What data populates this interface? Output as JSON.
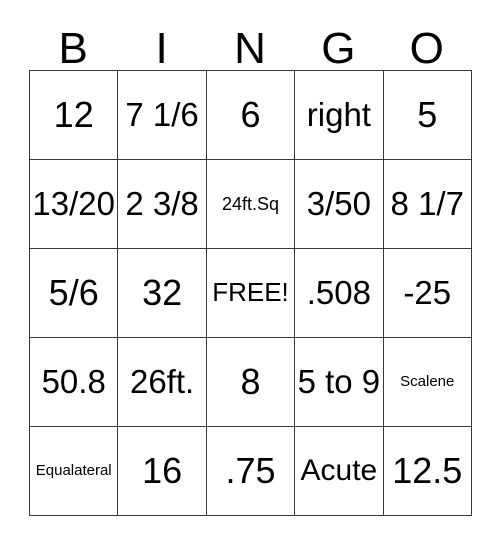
{
  "card": {
    "headers": [
      "B",
      "I",
      "N",
      "G",
      "O"
    ],
    "rows": [
      [
        {
          "text": "12",
          "size": "fs-xl"
        },
        {
          "text": "7 1/6",
          "size": "fs-lg"
        },
        {
          "text": "6",
          "size": "fs-xl"
        },
        {
          "text": "right",
          "size": "fs-lg"
        },
        {
          "text": "5",
          "size": "fs-xl"
        }
      ],
      [
        {
          "text": "13/20",
          "size": "fs-lg"
        },
        {
          "text": "2 3/8",
          "size": "fs-lg"
        },
        {
          "text": "24ft.Sq",
          "size": "fs-xs"
        },
        {
          "text": "3/50",
          "size": "fs-lg"
        },
        {
          "text": "8 1/7",
          "size": "fs-lg"
        }
      ],
      [
        {
          "text": "5/6",
          "size": "fs-xl"
        },
        {
          "text": "32",
          "size": "fs-xl"
        },
        {
          "text": "FREE!",
          "size": "fs-sm"
        },
        {
          "text": ".508",
          "size": "fs-lg"
        },
        {
          "text": "-25",
          "size": "fs-lg"
        }
      ],
      [
        {
          "text": "50.8",
          "size": "fs-lg"
        },
        {
          "text": "26ft.",
          "size": "fs-lg"
        },
        {
          "text": "8",
          "size": "fs-xl"
        },
        {
          "text": "5 to 9",
          "size": "fs-lg"
        },
        {
          "text": "Scalene",
          "size": "fs-xxs"
        }
      ],
      [
        {
          "text": "Equalateral",
          "size": "fs-xxs"
        },
        {
          "text": "16",
          "size": "fs-xl"
        },
        {
          "text": ".75",
          "size": "fs-xl"
        },
        {
          "text": "Acute",
          "size": "fs-md"
        },
        {
          "text": "12.5",
          "size": "fs-xl"
        }
      ]
    ]
  },
  "colors": {
    "background": "#ffffff",
    "text": "#000000",
    "border": "#3a3a3a"
  }
}
